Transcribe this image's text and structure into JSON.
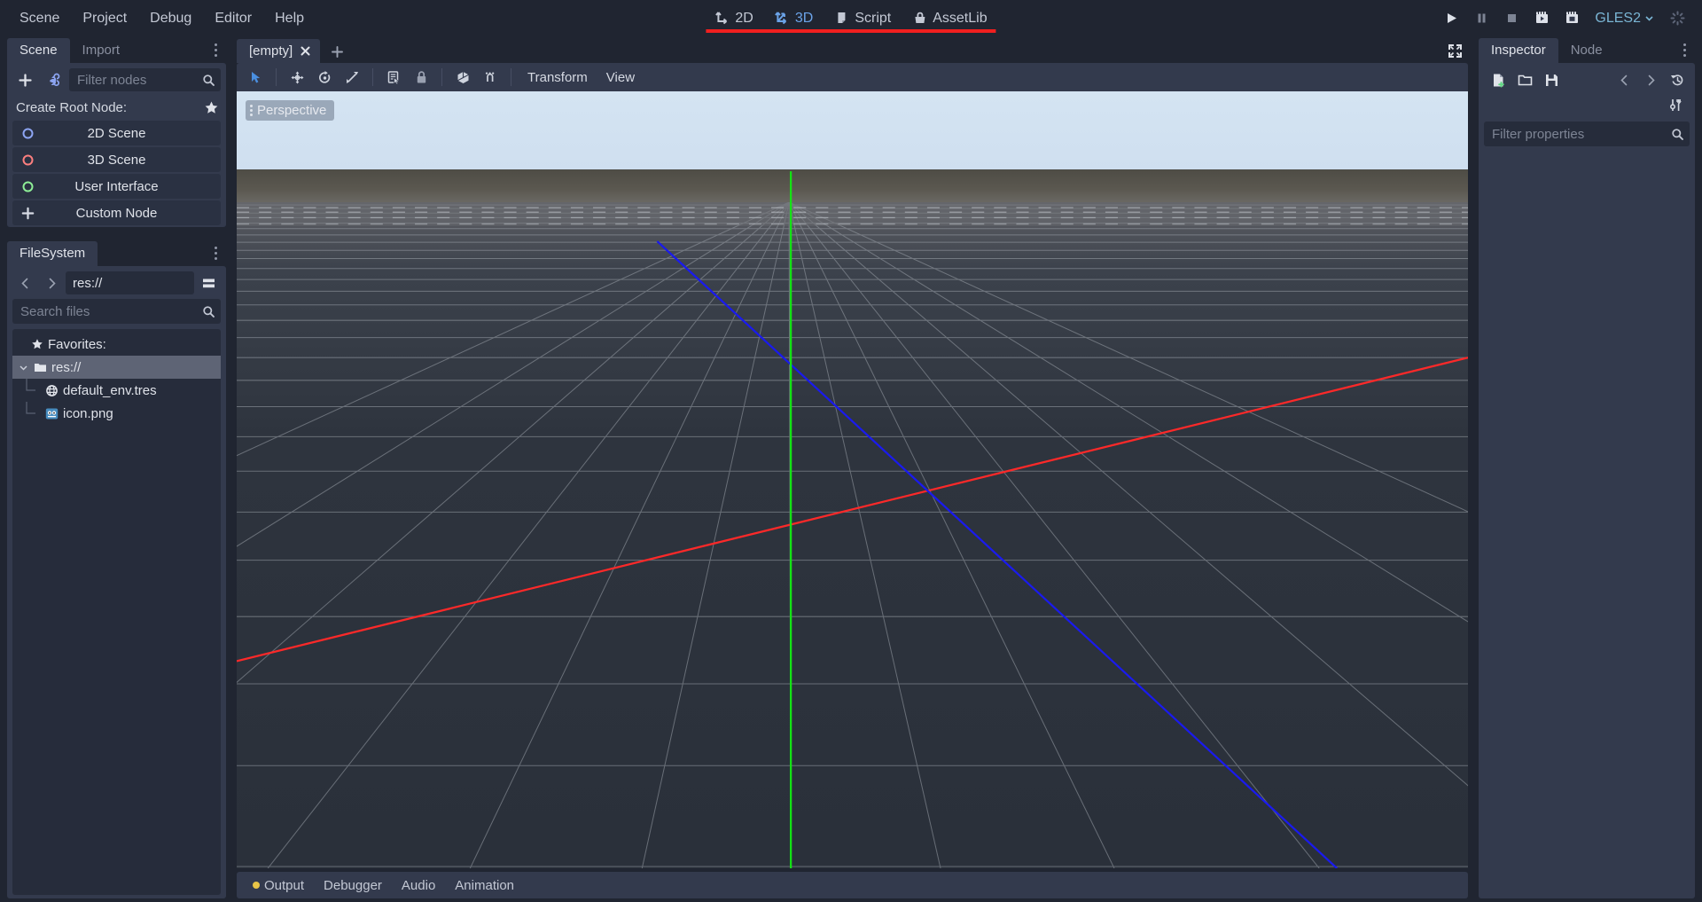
{
  "menubar": {
    "items": [
      {
        "label": "Scene",
        "name": "menu-scene"
      },
      {
        "label": "Project",
        "name": "menu-project"
      },
      {
        "label": "Debug",
        "name": "menu-debug"
      },
      {
        "label": "Editor",
        "name": "menu-editor"
      },
      {
        "label": "Help",
        "name": "menu-help"
      }
    ],
    "main_tabs": [
      {
        "label": "2D",
        "icon": "2d-icon",
        "active": false
      },
      {
        "label": "3D",
        "icon": "3d-icon",
        "active": true
      },
      {
        "label": "Script",
        "icon": "script-icon",
        "active": false
      },
      {
        "label": "AssetLib",
        "icon": "assetlib-icon",
        "active": false
      }
    ],
    "highlight_color": "#f01f1f",
    "run_buttons": [
      {
        "name": "play-button",
        "icon": "play-icon"
      },
      {
        "name": "pause-button",
        "icon": "pause-icon"
      },
      {
        "name": "stop-button",
        "icon": "stop-icon"
      },
      {
        "name": "play-scene-button",
        "icon": "play-scene-icon"
      },
      {
        "name": "play-custom-scene-button",
        "icon": "play-custom-scene-icon"
      }
    ],
    "renderer": {
      "label": "GLES2",
      "color": "#7ab5d4"
    },
    "progress": {
      "name": "busy-spinner-icon"
    }
  },
  "scene_dock": {
    "tabs": [
      {
        "label": "Scene",
        "active": true
      },
      {
        "label": "Import",
        "active": false
      }
    ],
    "toolbar": {
      "add_node": "add-node-icon",
      "instance_scene": "instance-scene-icon",
      "filter_placeholder": "Filter nodes",
      "search_icon": "search-icon"
    },
    "create_root_label": "Create Root Node:",
    "favorite_icon": "star-icon",
    "root_nodes": [
      {
        "label": "2D Scene",
        "icon": "node2d-icon",
        "color": "#8da5f3"
      },
      {
        "label": "3D Scene",
        "icon": "spatial-icon",
        "color": "#fc7f7f"
      },
      {
        "label": "User Interface",
        "icon": "control-icon",
        "color": "#8eef97"
      },
      {
        "label": "Custom Node",
        "icon": "plus-icon",
        "color": "#d7dbe5"
      }
    ]
  },
  "filesystem_dock": {
    "tabs": [
      {
        "label": "FileSystem",
        "active": true
      }
    ],
    "nav": {
      "back_icon": "chevron-left-icon",
      "forward_icon": "chevron-right-icon",
      "path": "res://",
      "split_mode_icon": "split-view-icon"
    },
    "search_placeholder": "Search files",
    "search_icon": "search-icon",
    "tree": [
      {
        "label": "Favorites:",
        "icon": "star-icon",
        "depth": 0,
        "selected": false,
        "type": "header"
      },
      {
        "label": "res://",
        "icon": "folder-icon",
        "depth": 0,
        "selected": true,
        "type": "folder",
        "expanded": true
      },
      {
        "label": "default_env.tres",
        "icon": "environment-icon",
        "depth": 1,
        "selected": false,
        "type": "file"
      },
      {
        "label": "icon.png",
        "icon": "godot-icon",
        "depth": 1,
        "selected": false,
        "type": "file"
      }
    ]
  },
  "scene_tabs": {
    "tabs": [
      {
        "label": "[empty]",
        "active": true,
        "close_icon": "close-icon"
      }
    ],
    "add_tab_icon": "plus-icon",
    "expand_icon": "fullscreen-icon"
  },
  "viewport_toolbar": {
    "tools": [
      {
        "name": "select-mode-button",
        "icon": "cursor-icon",
        "active": true
      },
      {
        "name": "move-mode-button",
        "icon": "move-icon",
        "active": false
      },
      {
        "name": "rotate-mode-button",
        "icon": "rotate-icon",
        "active": false
      },
      {
        "name": "scale-mode-button",
        "icon": "scale-icon",
        "active": false
      },
      {
        "name": "list-select-button",
        "icon": "list-select-icon",
        "active": false
      },
      {
        "name": "lock-button",
        "icon": "lock-icon",
        "active": false
      },
      {
        "name": "local-space-button",
        "icon": "cube-icon",
        "active": false
      },
      {
        "name": "snap-button",
        "icon": "snap-icon",
        "active": false
      }
    ],
    "menus": [
      {
        "label": "Transform",
        "name": "transform-menu"
      },
      {
        "label": "View",
        "name": "view-menu"
      }
    ]
  },
  "viewport": {
    "perspective_label": "Perspective",
    "sky_color": "#cfe0f0",
    "horizon_color": "#4a4843",
    "ground_color": "#2c323b",
    "axis_x_color": "#fc2929",
    "axis_y_color": "#0ee30e",
    "axis_z_color": "#1414f0",
    "grid_color": "#9aa0a8"
  },
  "bottom_panel": {
    "tabs": [
      {
        "label": "Output",
        "dot": true,
        "dot_color": "#e8c447"
      },
      {
        "label": "Debugger",
        "dot": false
      },
      {
        "label": "Audio",
        "dot": false
      },
      {
        "label": "Animation",
        "dot": false
      }
    ]
  },
  "inspector": {
    "tabs": [
      {
        "label": "Inspector",
        "active": true
      },
      {
        "label": "Node",
        "active": false
      }
    ],
    "toolbar": [
      {
        "name": "new-resource-button",
        "icon": "new-resource-icon"
      },
      {
        "name": "load-resource-button",
        "icon": "folder-open-icon"
      },
      {
        "name": "save-resource-button",
        "icon": "save-icon"
      },
      {
        "name": "history-back-button",
        "icon": "chevron-left-icon"
      },
      {
        "name": "history-forward-button",
        "icon": "chevron-right-icon"
      },
      {
        "name": "history-button",
        "icon": "history-icon"
      },
      {
        "name": "object-tools-button",
        "icon": "tools-icon"
      }
    ],
    "filter_placeholder": "Filter properties",
    "search_icon": "search-icon"
  }
}
